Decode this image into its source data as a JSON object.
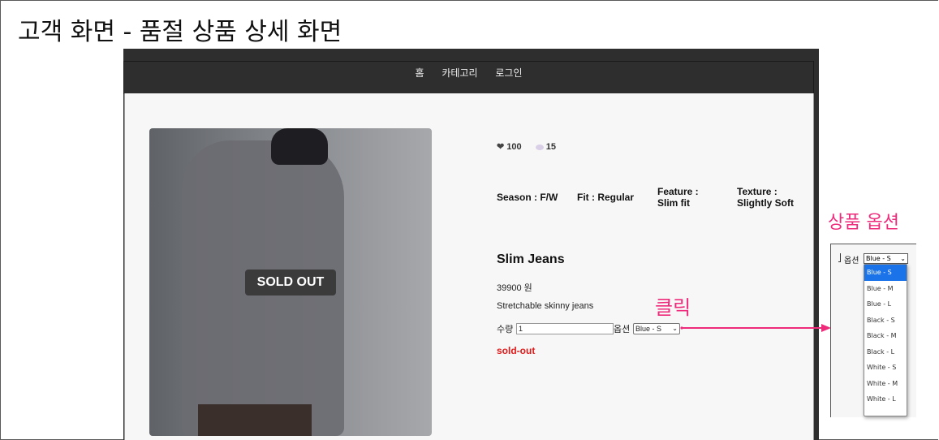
{
  "slide_title": "고객 화면 - 품절 상품 상세 화면",
  "nav": {
    "items": [
      "홈",
      "카테고리",
      "로그인"
    ]
  },
  "product": {
    "badge": "SOLD OUT",
    "likes": "100",
    "comments": "15",
    "attributes": [
      {
        "line1": "Season : F/W",
        "line2": ""
      },
      {
        "line1": "Fit : Regular",
        "line2": ""
      },
      {
        "line1": "Feature :",
        "line2": "Slim fit"
      },
      {
        "line1": "Texture :",
        "line2": "Slightly Soft"
      }
    ],
    "name": "Slim Jeans",
    "price": "39900 원",
    "description": "Stretchable skinny jeans",
    "quantity_label": "수량",
    "quantity_value": "1",
    "option_label": "옵션",
    "option_selected": "Blue - S",
    "status_text": "sold-out"
  },
  "annotations": {
    "click": "클릭",
    "option_panel_title": "상품 옵션"
  },
  "dropdown": {
    "label": "옵션",
    "selected": "Blue - S",
    "options": [
      "Blue - S",
      "Blue - M",
      "Blue - L",
      "Black - S",
      "Black - M",
      "Black - L",
      "White - S",
      "White - M",
      "White - L"
    ]
  },
  "colors": {
    "annotation": "#ee2a7b",
    "soldout_text": "#e01a1a",
    "nav_bg": "#2e2e2e",
    "option_highlight": "#1a73e8"
  },
  "icons": {
    "likes": "heart-icon",
    "comments": "speech-bubble-icon"
  }
}
